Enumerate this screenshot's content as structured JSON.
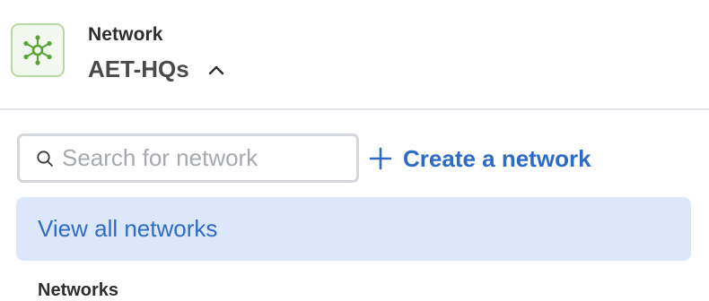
{
  "header": {
    "kicker": "Network",
    "current_network": "AET-HQs",
    "logo_icon": "network-hub-icon",
    "logo_color": "#5aa33a",
    "chevron_icon": "chevron-up-icon"
  },
  "search": {
    "placeholder": "Search for network",
    "value": "",
    "icon": "search-icon"
  },
  "create": {
    "label": "Create a network",
    "icon": "plus-icon"
  },
  "view_all": {
    "label": "View all networks"
  },
  "list": {
    "section_title": "Networks"
  },
  "colors": {
    "accent": "#2d6bc4",
    "highlight_bg": "#dde7fb",
    "divider": "#e3e6ea"
  }
}
